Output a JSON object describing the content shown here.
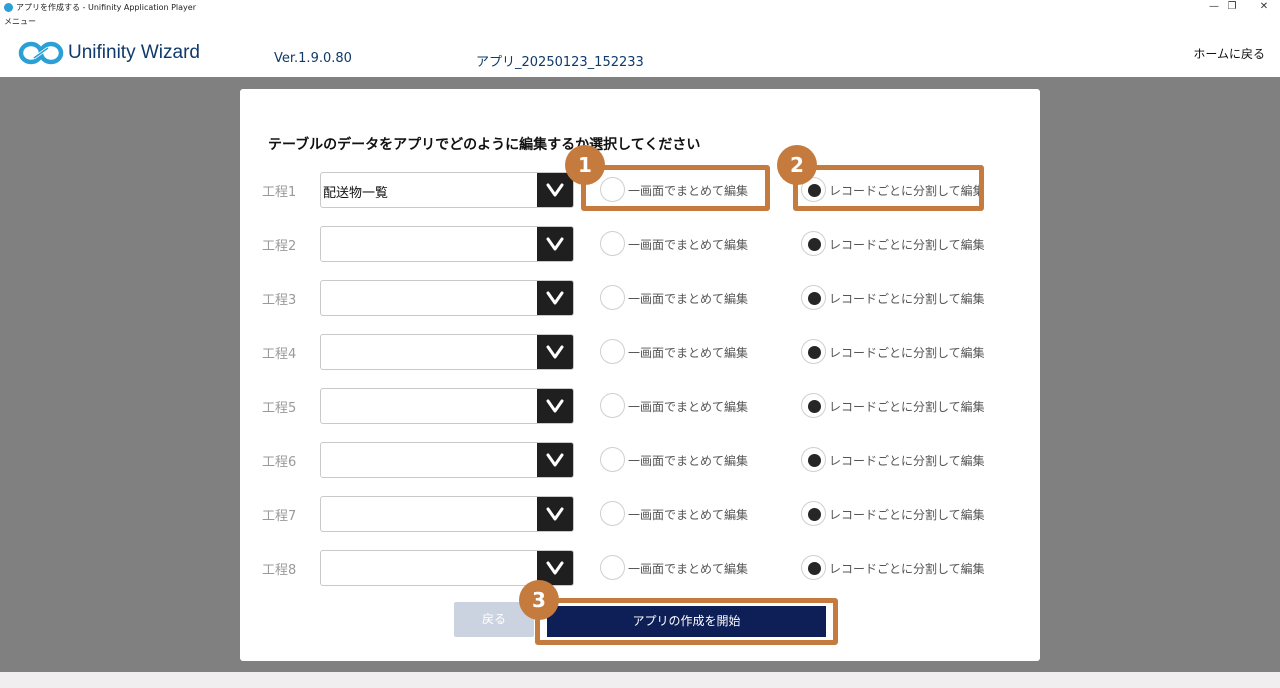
{
  "window": {
    "title": "アプリを作成する - Unifinity Application Player",
    "menu": "メニュー",
    "controls": {
      "minimize": "—",
      "restore": "❐",
      "close": "✕"
    }
  },
  "header": {
    "logo_text": "Unifinity Wizard",
    "version": "Ver.1.9.0.80",
    "app_name": "アプリ_20250123_152233",
    "home_link": "ホームに戻る"
  },
  "dialog": {
    "question": "テーブルのデータをアプリでどのように編集するか選択してください",
    "option_a_label": "一画面でまとめて編集",
    "option_b_label": "レコードごとに分割して編集",
    "rows": [
      {
        "label": "工程1",
        "value": "配送物一覧",
        "selected": "b"
      },
      {
        "label": "工程2",
        "value": "",
        "selected": "b"
      },
      {
        "label": "工程3",
        "value": "",
        "selected": "b"
      },
      {
        "label": "工程4",
        "value": "",
        "selected": "b"
      },
      {
        "label": "工程5",
        "value": "",
        "selected": "b"
      },
      {
        "label": "工程6",
        "value": "",
        "selected": "b"
      },
      {
        "label": "工程7",
        "value": "",
        "selected": "b"
      },
      {
        "label": "工程8",
        "value": "",
        "selected": "b"
      }
    ],
    "back_button": "戻る",
    "start_button": "アプリの作成を開始"
  },
  "callouts": [
    "1",
    "2",
    "3"
  ],
  "colors": {
    "brand": "#0f3a6b",
    "primary_button": "#0e1f57",
    "disabled_button": "#ccd3e0",
    "callout": "#c57a3e",
    "backdrop": "#808080"
  }
}
